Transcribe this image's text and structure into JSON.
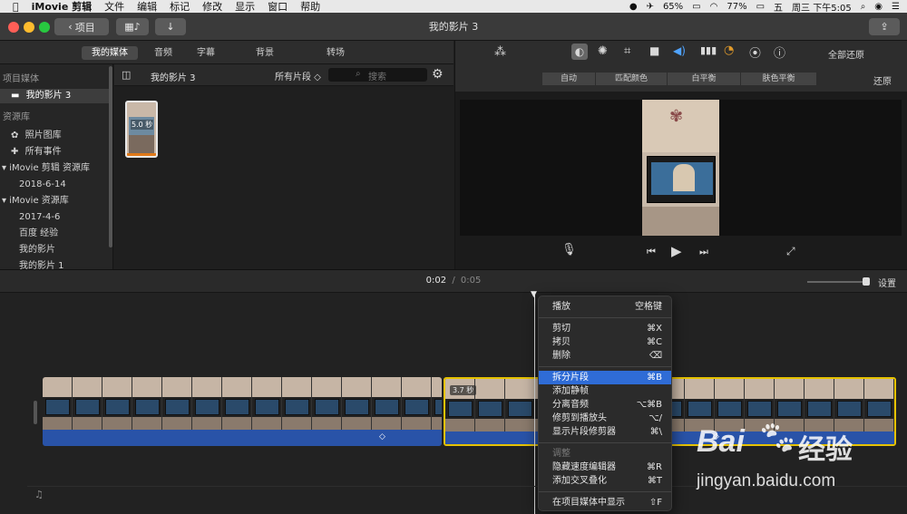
{
  "menubar": {
    "items": [
      "iMovie 剪辑",
      "文件",
      "编辑",
      "标记",
      "修改",
      "显示",
      "窗口",
      "帮助"
    ],
    "battery_pct": "65%",
    "battery2": "77%",
    "input_char": "五",
    "clock": "周三 下午5:05"
  },
  "window": {
    "title": "我的影片 3",
    "back_label": "项目"
  },
  "media_tabs": [
    "我的媒体",
    "音频",
    "字幕",
    "背景",
    "转场"
  ],
  "sidebar": {
    "section_project": "项目媒体",
    "project_item": "我的影片 3",
    "section_library": "资源库",
    "photos": "照片图库",
    "all_events": "所有事件",
    "library1": "iMovie 剪辑 资源库",
    "lib1_child": "2018-6-14",
    "library2": "iMovie 资源库",
    "lib2_children": [
      "2017-4-6",
      "百度 经验",
      "我的影片",
      "我的影片 1"
    ]
  },
  "browser": {
    "title": "我的影片 3",
    "filter": "所有片段 ◇",
    "search_placeholder": "搜索",
    "clip_duration": "5.0 秒"
  },
  "viewer": {
    "reset_all": "全部还原",
    "reset": "还原",
    "adjust_tabs": [
      "自动",
      "匹配颜色",
      "白平衡",
      "肤色平衡"
    ]
  },
  "timeline": {
    "current_time": "0:02",
    "separator": "/",
    "total_time": "0:05",
    "settings_label": "设置",
    "clip2_duration": "3.7 秒"
  },
  "context_menu": {
    "items": [
      {
        "label": "播放",
        "shortcut": "空格键",
        "state": "normal"
      },
      {
        "label": "剪切",
        "shortcut": "⌘X",
        "state": "normal"
      },
      {
        "label": "拷贝",
        "shortcut": "⌘C",
        "state": "normal"
      },
      {
        "label": "删除",
        "shortcut": "⌫",
        "state": "normal"
      },
      {
        "label": "拆分片段",
        "shortcut": "⌘B",
        "state": "highlighted"
      },
      {
        "label": "添加静帧",
        "shortcut": "",
        "state": "normal"
      },
      {
        "label": "分离音频",
        "shortcut": "⌥⌘B",
        "state": "normal"
      },
      {
        "label": "修剪到播放头",
        "shortcut": "⌥/",
        "state": "normal"
      },
      {
        "label": "显示片段修剪器",
        "shortcut": "⌘\\",
        "state": "normal"
      },
      {
        "label": "调整",
        "shortcut": "",
        "state": "disabled"
      },
      {
        "label": "隐藏速度编辑器",
        "shortcut": "⌘R",
        "state": "normal"
      },
      {
        "label": "添加交叉叠化",
        "shortcut": "⌘T",
        "state": "normal"
      },
      {
        "label": "在项目媒体中显示",
        "shortcut": "⇧F",
        "state": "normal"
      }
    ]
  },
  "watermark": {
    "brand": "Bai",
    "brand_cn": "经验",
    "url": "jingyan.baidu.com"
  },
  "colors": {
    "accent": "#2f6cd6",
    "clip_border_selected": "#e6c200",
    "audio_track": "#2953a8",
    "close": "#fe5f57",
    "minimize": "#febc2e",
    "zoom": "#28c840"
  }
}
